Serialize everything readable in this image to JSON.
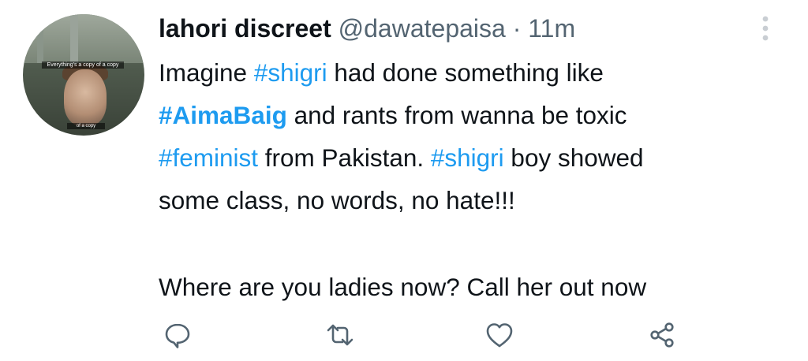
{
  "tweet": {
    "author": {
      "display_name": "lahori discreet",
      "handle": "@dawatepaisa",
      "separator": "·",
      "time": "11m",
      "avatar_caption_top": "Everything's a copy of a copy",
      "avatar_caption_bottom": "of a copy"
    },
    "lines": [
      [
        {
          "text": "Imagine ",
          "type": "text"
        },
        {
          "text": "#shigri",
          "type": "hashtag"
        },
        {
          "text": " had done something like",
          "type": "text"
        }
      ],
      [
        {
          "text": "#AimaBaig",
          "type": "hashtag-strong"
        },
        {
          "text": " and rants from wanna be toxic",
          "type": "text"
        }
      ],
      [
        {
          "text": "#feminist",
          "type": "hashtag"
        },
        {
          "text": " from Pakistan. ",
          "type": "text"
        },
        {
          "text": "#shigri",
          "type": "hashtag"
        },
        {
          "text": " boy showed",
          "type": "text"
        }
      ],
      [
        {
          "text": "some class, no words, no hate!!!",
          "type": "text"
        }
      ],
      [],
      [
        {
          "text": "Where are you ladies now? Call her out now",
          "type": "text"
        }
      ]
    ],
    "actions": [
      "reply-icon",
      "retweet-icon",
      "like-icon",
      "share-icon"
    ],
    "colors": {
      "text": "#0f1419",
      "secondary": "#536471",
      "link": "#1d9bf0"
    }
  }
}
